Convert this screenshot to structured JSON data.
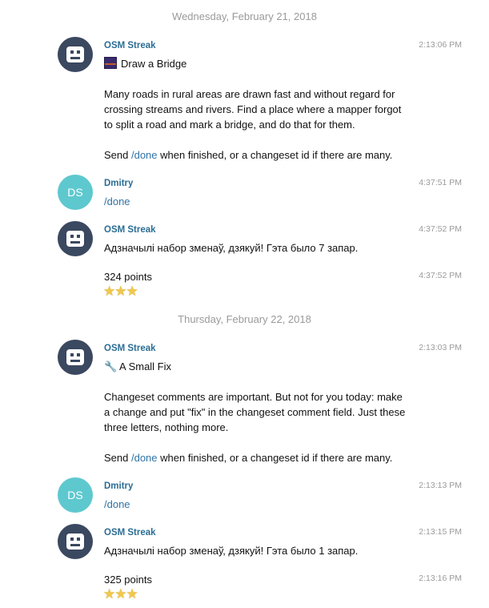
{
  "dates": [
    "Wednesday, February 21, 2018",
    "Thursday, February 22, 2018"
  ],
  "bot_name": "OSM Streak",
  "user": {
    "name": "Dmitry",
    "initials": "DS"
  },
  "colors": {
    "bot_avatar": "#3a4860",
    "user_avatar": "#5ec8cf",
    "name": "#2a6d95",
    "link": "#2f73a5"
  },
  "messages": [
    {
      "time": "2:13:06 PM",
      "task_icon": "bridge-icon",
      "task_title": "Draw a Bridge",
      "body": [
        "Many roads in rural areas are drawn fast and without regard for",
        "crossing streams and rivers. Find a place where a mapper forgot",
        "to split a road and mark a bridge, and do that for them."
      ],
      "send_prefix": "Send ",
      "send_link": "/done",
      "send_suffix": " when finished, or a changeset id if there are many."
    },
    {
      "time": "4:37:51 PM",
      "text": "/done"
    },
    {
      "time": "4:37:52 PM",
      "text": "Адзначылі набор зменаў, дзякуй! Гэта было 7 запар."
    },
    {
      "time": "4:37:52 PM",
      "points": "324 points",
      "stars": 3
    },
    {
      "time": "2:13:03 PM",
      "task_icon": "wrench-icon",
      "task_title": "A Small Fix",
      "body": [
        "Changeset comments are important. But not for you today: make",
        "a change and put \"fix\" in the changeset comment field. Just these",
        "three letters, nothing more."
      ],
      "send_prefix": "Send ",
      "send_link": "/done",
      "send_suffix": " when finished, or a changeset id if there are many."
    },
    {
      "time": "2:13:13 PM",
      "text": "/done"
    },
    {
      "time": "2:13:15 PM",
      "text": "Адзначылі набор зменаў, дзякуй! Гэта было 1 запар."
    },
    {
      "time": "2:13:16 PM",
      "points": "325 points",
      "stars": 3
    }
  ]
}
